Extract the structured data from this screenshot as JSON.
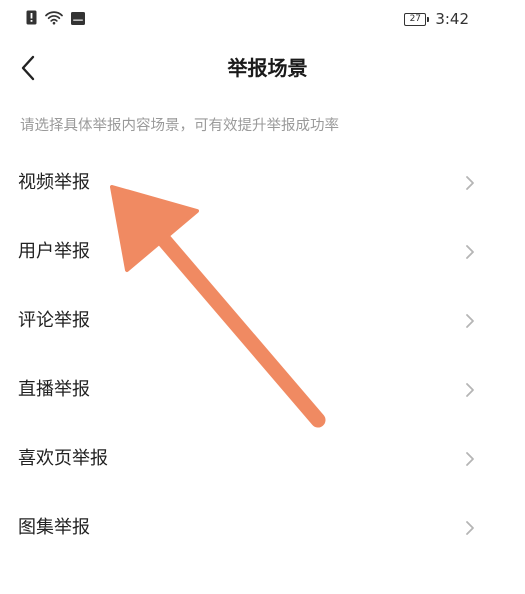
{
  "status_bar": {
    "time": "3:42",
    "battery_level": "27",
    "icons": [
      "alert-icon",
      "wifi-icon",
      "hd-icon"
    ]
  },
  "header": {
    "title": "举报场景",
    "back_icon": "chevron-left-icon"
  },
  "instruction": "请选择具体举报内容场景，可有效提升举报成功率",
  "report_items": [
    {
      "label": "视频举报"
    },
    {
      "label": "用户举报"
    },
    {
      "label": "评论举报"
    },
    {
      "label": "直播举报"
    },
    {
      "label": "喜欢页举报"
    },
    {
      "label": "图集举报"
    }
  ],
  "colors": {
    "accent_arrow": "#f08a62",
    "title_text": "#1a1a1a",
    "item_text": "#222222",
    "hint_text": "#9a9a9a",
    "chevron": "#b5b5b5"
  }
}
